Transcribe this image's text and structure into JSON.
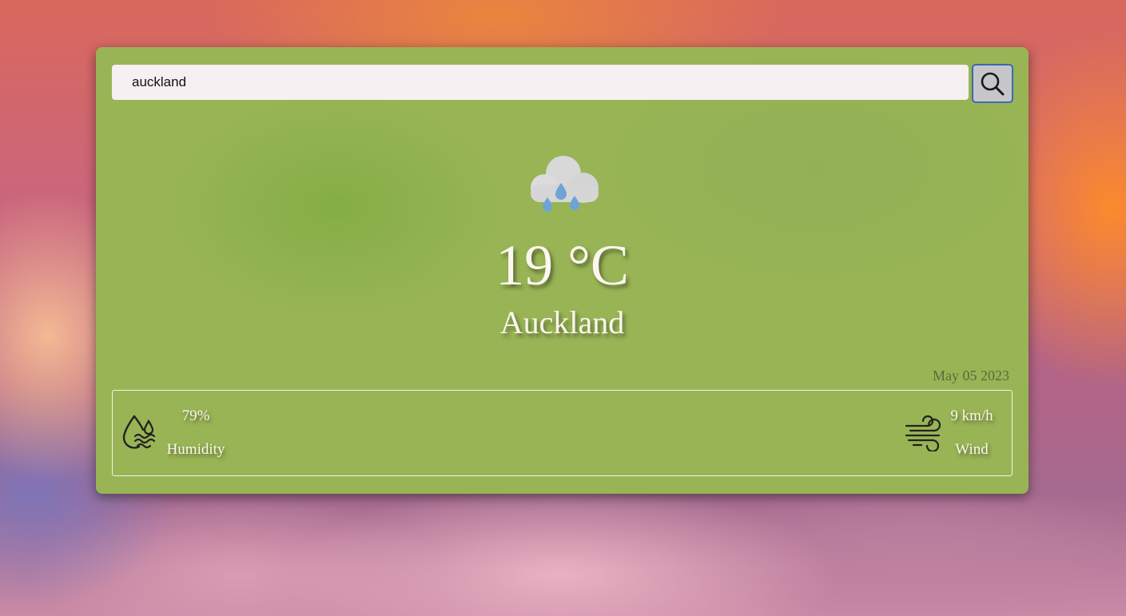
{
  "search": {
    "value": "auckland",
    "placeholder": ""
  },
  "weather": {
    "icon": "rain-cloud-icon",
    "temperature": "19 °C",
    "city": "Auckland",
    "date": "May 05 2023"
  },
  "details": {
    "humidity": {
      "icon": "humidity-icon",
      "value": "79%",
      "label": "Humidity"
    },
    "wind": {
      "icon": "wind-icon",
      "value": "9 km/h",
      "label": "Wind"
    }
  },
  "colors": {
    "card": "#98b455",
    "search_field": "#f7f0f2",
    "search_button": "#c6c6c8",
    "search_button_border": "#3c68b8",
    "text": "#fbf6ee",
    "date_text": "#5a6b3a",
    "raindrop": "#6fa3d6"
  }
}
